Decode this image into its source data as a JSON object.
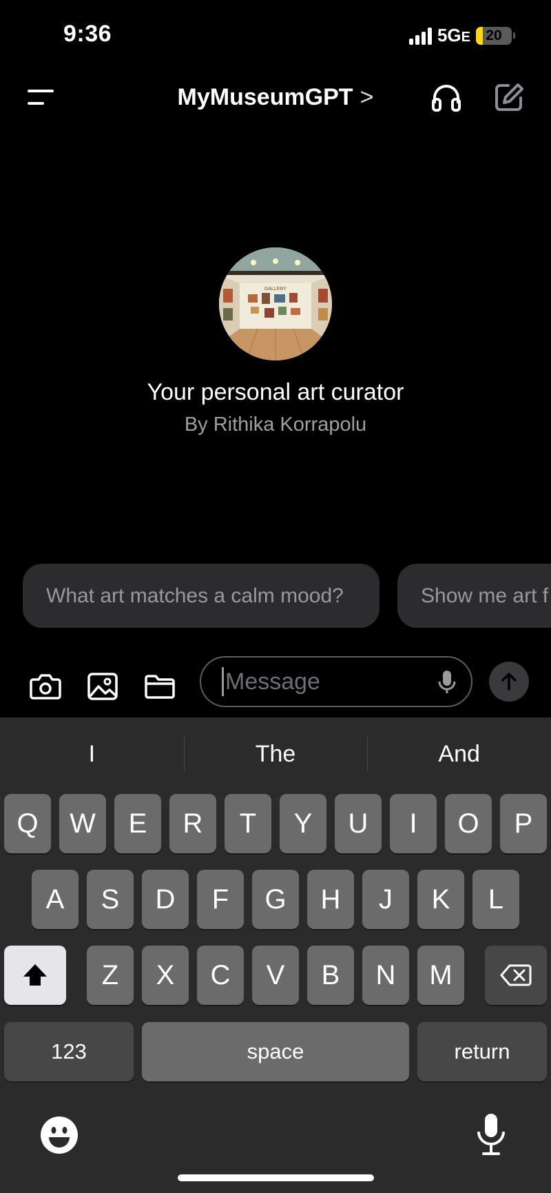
{
  "status_bar": {
    "time": "9:36",
    "network": "5G",
    "network_suffix": "E",
    "battery": "20",
    "battery_level": 0.2
  },
  "nav": {
    "title": "MyMuseumGPT",
    "chevron": ">"
  },
  "profile": {
    "tagline": "Your personal art curator",
    "byline": "By Rithika Korrapolu",
    "avatar_sign": "GALLERY"
  },
  "suggestions": [
    {
      "text": "What art matches a calm mood?"
    },
    {
      "text": "Show me art f"
    }
  ],
  "composer": {
    "placeholder": "Message"
  },
  "keyboard": {
    "predictions": [
      "I",
      "The",
      "And"
    ],
    "row1": [
      "Q",
      "W",
      "E",
      "R",
      "T",
      "Y",
      "U",
      "I",
      "O",
      "P"
    ],
    "row2": [
      "A",
      "S",
      "D",
      "F",
      "G",
      "H",
      "J",
      "K",
      "L"
    ],
    "row3": [
      "Z",
      "X",
      "C",
      "V",
      "B",
      "N",
      "M"
    ],
    "numbers_label": "123",
    "space_label": "space",
    "return_label": "return"
  },
  "icons": {
    "menu": "menu-icon",
    "headphones": "headphones-icon",
    "compose": "compose-icon",
    "camera": "camera-icon",
    "photo": "photo-icon",
    "folder": "folder-icon",
    "microphone": "microphone-icon",
    "send": "arrow-up-icon",
    "shift": "shift-icon",
    "delete": "delete-icon",
    "emoji": "emoji-icon",
    "dictation": "dictation-icon"
  },
  "colors": {
    "background": "#000000",
    "keyboard": "#2b2b2b",
    "battery_fill": "#ffd60a",
    "chip": "#2c2c2e"
  }
}
